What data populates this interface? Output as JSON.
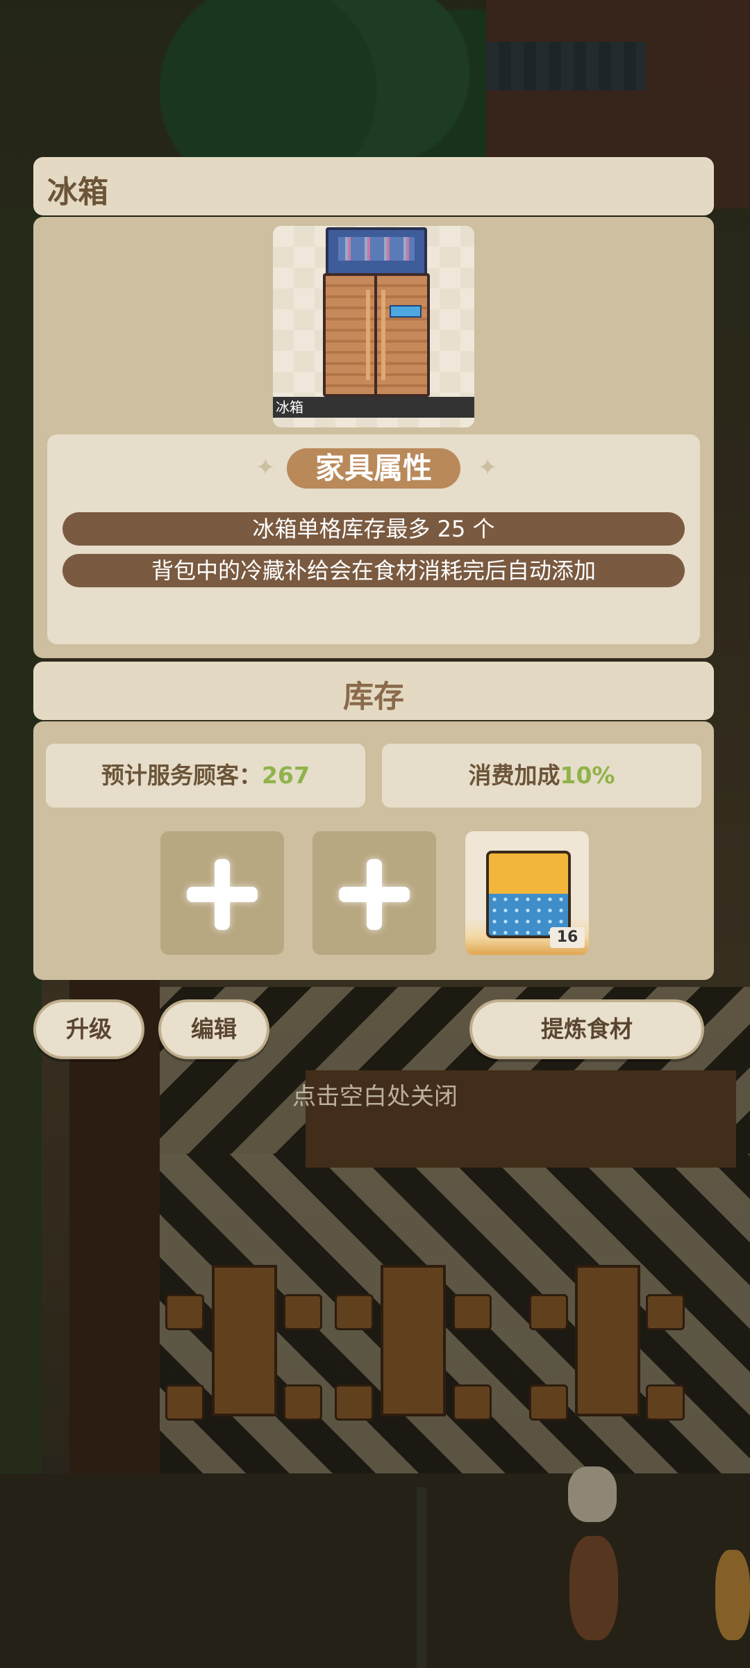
{
  "dialog": {
    "title": "冰箱",
    "item_label": "冰箱",
    "attributes_title": "家具属性",
    "attributes": [
      "冰箱单格库存最多 25 个",
      "背包中的冷藏补给会在食材消耗完后自动添加"
    ]
  },
  "stock": {
    "title": "库存",
    "customers_label": "预计服务顾客：",
    "customers_value": "267",
    "bonus_label": "消费加成",
    "bonus_value": "10%",
    "slots": [
      {
        "type": "empty",
        "icon": "plus-icon"
      },
      {
        "type": "empty",
        "icon": "plus-icon"
      },
      {
        "type": "item",
        "icon": "ice-supply-icon",
        "count": "16"
      }
    ]
  },
  "buttons": {
    "upgrade": "升级",
    "edit": "编辑",
    "refine": "提炼食材"
  },
  "close_hint": "点击空白处关闭",
  "colors": {
    "panel": "#cdbf9f",
    "header": "#e4dac4",
    "accent_pill": "#b9895a",
    "info_row": "#7a5a40",
    "highlight": "#8fb34a"
  }
}
